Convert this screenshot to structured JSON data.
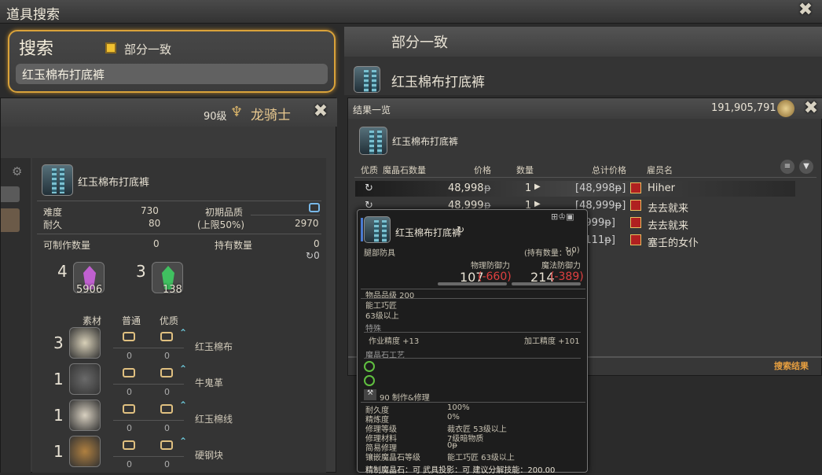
{
  "window": {
    "title": "道具搜索"
  },
  "search": {
    "label": "搜索",
    "checkbox_label": "部分一致",
    "query": "红玉棉布打底裤"
  },
  "left": {
    "level": "90级",
    "job": "龙骑士",
    "item_name": "红玉棉布打底裤",
    "difficulty_label": "难度",
    "difficulty": "730",
    "durability_label": "耐久",
    "durability": "80",
    "initial_quality_label": "初期品质",
    "initial_quality_cap": "(上限50%)",
    "quality_max": "2970",
    "craftable_label": "可制作数量",
    "craftable": "0",
    "held_label": "持有数量",
    "held": "0",
    "held_hq": "0",
    "crystals": [
      {
        "need": "4",
        "have": "5906",
        "color": "#c060d0"
      },
      {
        "need": "3",
        "have": "138",
        "color": "#40c060"
      }
    ],
    "mat_headers": {
      "material": "素材",
      "normal": "普通",
      "hq": "优质"
    },
    "materials": [
      {
        "qty": "3",
        "name": "红玉棉布",
        "n": "0",
        "h": "0",
        "color": "#d8d0b8"
      },
      {
        "qty": "1",
        "name": "牛鬼革",
        "n": "0",
        "h": "0",
        "color": "#6a6a6a"
      },
      {
        "qty": "1",
        "name": "红玉棉线",
        "n": "0",
        "h": "0",
        "color": "#d8d0c0"
      },
      {
        "qty": "1",
        "name": "硬钢块",
        "n": "0",
        "h": "0",
        "color": "#b08040"
      }
    ]
  },
  "right": {
    "header": "部分一致",
    "item_name": "红玉棉布打底裤",
    "results_title": "结果一览",
    "gil": "191,905,791",
    "result_item": "红玉棉布打底裤",
    "columns": [
      "优质",
      "魔晶石数量",
      "价格",
      "数量",
      "总计价格",
      "雇员名"
    ],
    "rows": [
      {
        "price": "48,998",
        "unit": "ᵽ",
        "qty": "1",
        "total": "[48,998ᵽ]",
        "retainer": "Hiher"
      },
      {
        "price": "48,999",
        "unit": "ᵽ",
        "qty": "1",
        "total": "[48,999ᵽ]",
        "retainer": "去去就来"
      },
      {
        "price": "",
        "unit": "",
        "qty": "",
        "total": "8,999ᵽ]",
        "retainer": "去去就来"
      },
      {
        "price": "",
        "unit": "",
        "qty": "",
        "total": "9,111ᵽ]",
        "retainer": "塞壬的女仆"
      }
    ],
    "footer": "搜索结果"
  },
  "tooltip": {
    "name": "红玉棉布打底裤",
    "slot": "腿部防具",
    "held": "(持有数量：0/",
    "held_hq": "0)",
    "phys_label": "物理防御力",
    "phys": "107",
    "phys_diff": "(-660)",
    "mag_label": "魔法防御力",
    "mag": "214",
    "mag_diff": "(-389)",
    "ilvl": "物品品级 200",
    "job": "能工巧匠",
    "req": "63级以上",
    "special_label": "特殊",
    "stat1": "作业精度 +13",
    "stat2": "加工精度 +101",
    "materia_label": "魔晶石工艺",
    "repair_line": "90 制作&修理",
    "props": [
      [
        "耐久度",
        "100%"
      ],
      [
        "精炼度",
        "0%"
      ],
      [
        "修理等级",
        "裁衣匠 53级以上"
      ],
      [
        "修理材料",
        "7级暗物质"
      ],
      [
        "简易修理",
        "0ᵽ"
      ],
      [
        "镶嵌魔晶石等级",
        "能工巧匠 63级以上"
      ]
    ],
    "last": "精制魔晶石：可   武具投影：可   建议分解技能：200.00"
  }
}
